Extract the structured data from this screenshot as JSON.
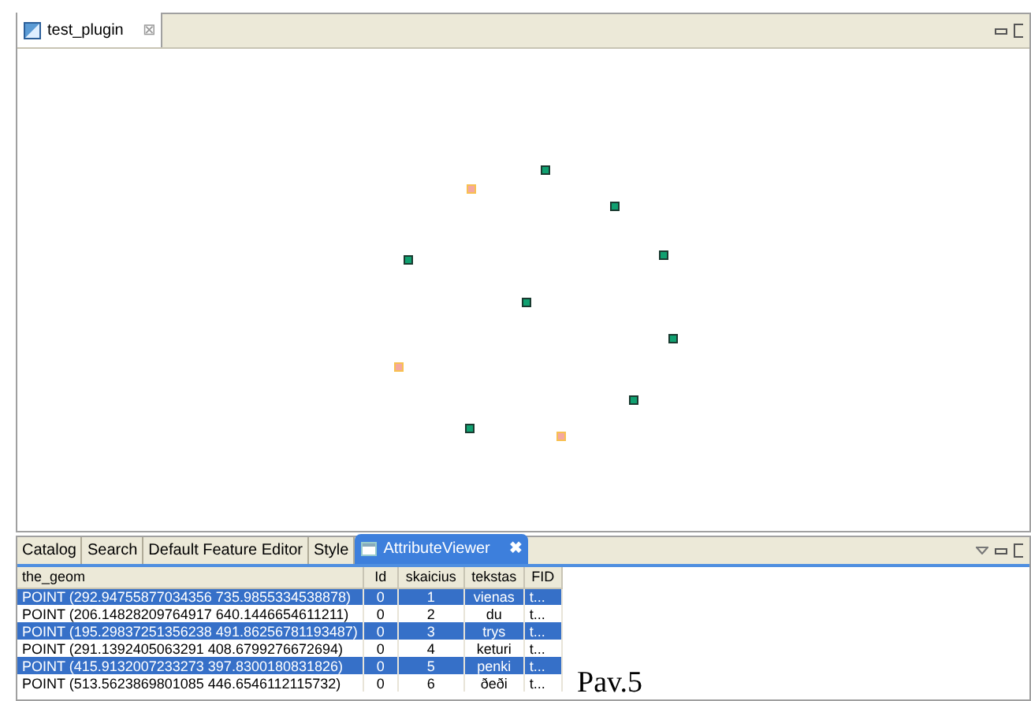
{
  "editor_tab": {
    "title": "test_plugin",
    "close": "⊠"
  },
  "map_points": [
    {
      "selected": false
    },
    {
      "selected": true
    },
    {
      "selected": false
    },
    {
      "selected": false
    },
    {
      "selected": false
    },
    {
      "selected": false
    },
    {
      "selected": false
    },
    {
      "selected": true
    },
    {
      "selected": false
    },
    {
      "selected": false
    },
    {
      "selected": true
    }
  ],
  "panel_tabs": [
    {
      "label": "Catalog",
      "selected": false
    },
    {
      "label": "Search",
      "selected": false
    },
    {
      "label": "Default Feature Editor",
      "selected": false
    },
    {
      "label": "Style",
      "selected": false
    },
    {
      "label": "AttributeViewer",
      "selected": true,
      "close": "✖"
    }
  ],
  "table": {
    "columns": [
      "the_geom",
      "Id",
      "skaicius",
      "tekstas",
      "FID"
    ],
    "rows": [
      {
        "selected": true,
        "cells": [
          "POINT (292.94755877034356 735.9855334538878)",
          "0",
          "1",
          "vienas",
          "t..."
        ]
      },
      {
        "selected": false,
        "cells": [
          "POINT (206.14828209764917 640.1446654611211)",
          "0",
          "2",
          "du",
          "t..."
        ]
      },
      {
        "selected": true,
        "cells": [
          "POINT (195.29837251356238 491.86256781193487)",
          "0",
          "3",
          "trys",
          "t..."
        ]
      },
      {
        "selected": false,
        "cells": [
          "POINT (291.1392405063291 408.6799276672694)",
          "0",
          "4",
          "keturi",
          "t..."
        ]
      },
      {
        "selected": true,
        "cells": [
          "POINT (415.9132007233273 397.8300180831826)",
          "0",
          "5",
          "penki",
          "t..."
        ]
      },
      {
        "selected": false,
        "cells": [
          "POINT (513.5623869801085 446.6546112115732)",
          "0",
          "6",
          "ðeði",
          "t..."
        ]
      }
    ]
  },
  "caption": "Pav.5"
}
